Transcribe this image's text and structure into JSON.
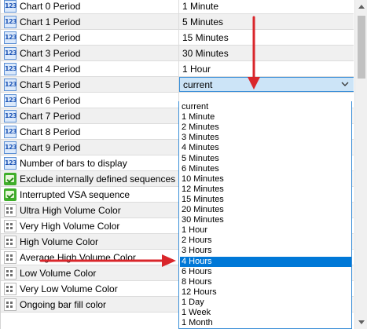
{
  "properties": [
    {
      "name": "Chart 0 Period",
      "value": "1 Minute",
      "icon": "integer-icon"
    },
    {
      "name": "Chart 1 Period",
      "value": "5 Minutes",
      "icon": "integer-icon"
    },
    {
      "name": "Chart 2 Period",
      "value": "15 Minutes",
      "icon": "integer-icon"
    },
    {
      "name": "Chart 3 Period",
      "value": "30 Minutes",
      "icon": "integer-icon"
    },
    {
      "name": "Chart 4 Period",
      "value": "1 Hour",
      "icon": "integer-icon"
    },
    {
      "name": "Chart 5 Period",
      "value": "current",
      "icon": "integer-icon",
      "selected": true
    },
    {
      "name": "Chart 6 Period",
      "value": "",
      "icon": "integer-icon"
    },
    {
      "name": "Chart 7 Period",
      "value": "",
      "icon": "integer-icon"
    },
    {
      "name": "Chart 8 Period",
      "value": "",
      "icon": "integer-icon"
    },
    {
      "name": "Chart 9 Period",
      "value": "",
      "icon": "integer-icon"
    },
    {
      "name": "Number of bars to display",
      "value": "",
      "icon": "integer-icon"
    },
    {
      "name": "Exclude internally defined sequences",
      "value": "",
      "icon": "boolean-icon"
    },
    {
      "name": "Interrupted VSA sequence",
      "value": "",
      "icon": "boolean-icon"
    },
    {
      "name": "Ultra High Volume Color",
      "value": "",
      "icon": "color-icon"
    },
    {
      "name": "Very High Volume Color",
      "value": "",
      "icon": "color-icon"
    },
    {
      "name": "High Volume Color",
      "value": "",
      "icon": "color-icon"
    },
    {
      "name": "Average High Volume Color",
      "value": "",
      "icon": "color-icon"
    },
    {
      "name": "Low Volume Color",
      "value": "",
      "icon": "color-icon"
    },
    {
      "name": "Very Low Volume Color",
      "value": "",
      "icon": "color-icon"
    },
    {
      "name": "Ongoing bar fill color",
      "value": "",
      "icon": "color-icon"
    }
  ],
  "icon_text": {
    "integer": "123"
  },
  "dropdown": {
    "options": [
      "current",
      "1 Minute",
      "2 Minutes",
      "3 Minutes",
      "4 Minutes",
      "5 Minutes",
      "6 Minutes",
      "10 Minutes",
      "12 Minutes",
      "15 Minutes",
      "20 Minutes",
      "30 Minutes",
      "1 Hour",
      "2 Hours",
      "3 Hours",
      "4 Hours",
      "6 Hours",
      "8 Hours",
      "12 Hours",
      "1 Day",
      "1 Week",
      "1 Month"
    ],
    "highlighted": "4 Hours"
  },
  "annotation_color": "#d9262b",
  "highlight_color": "#0078d7"
}
